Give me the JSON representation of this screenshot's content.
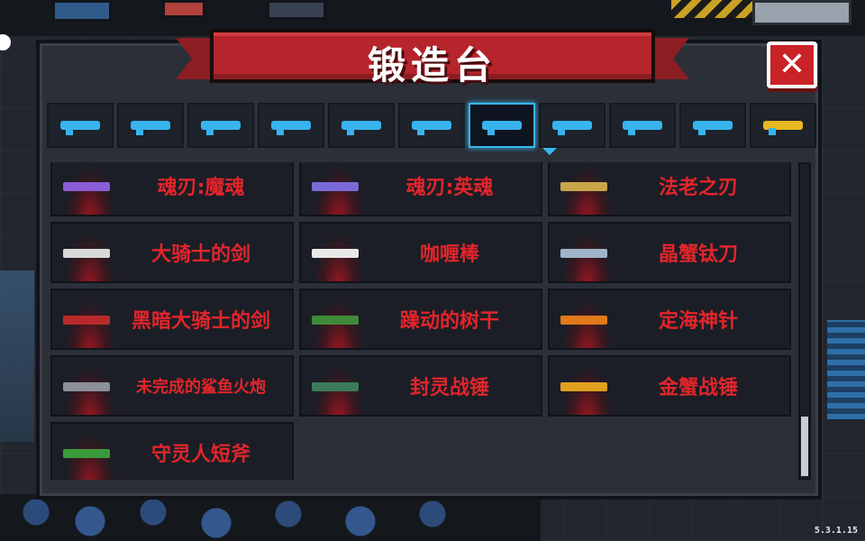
{
  "title": "锻造台",
  "close_icon": "close-x-icon",
  "colors": {
    "banner": "#b5252b",
    "close": "#c92227",
    "accent": "#37b4ee",
    "item_text": "#e2252b"
  },
  "tabs": [
    {
      "icon": "pistol-icon",
      "active": false
    },
    {
      "icon": "rifle-icon",
      "active": false
    },
    {
      "icon": "shotgun-icon",
      "active": false
    },
    {
      "icon": "launcher-icon",
      "active": false
    },
    {
      "icon": "laser-gun-icon",
      "active": false
    },
    {
      "icon": "bow-icon",
      "active": false
    },
    {
      "icon": "sword-icon",
      "active": true
    },
    {
      "icon": "spear-icon",
      "active": false
    },
    {
      "icon": "shuriken-icon",
      "active": false
    },
    {
      "icon": "fish-icon",
      "active": false
    },
    {
      "icon": "special-icon",
      "active": false
    }
  ],
  "items": [
    {
      "name": "魂刃:魔魂",
      "icon": "soul-blade-demon-icon",
      "icon_color": "#8a5cd6"
    },
    {
      "name": "魂刃:英魂",
      "icon": "soul-blade-hero-icon",
      "icon_color": "#7a6ad8"
    },
    {
      "name": "法老之刃",
      "icon": "pharaoh-blade-icon",
      "icon_color": "#c9a64a"
    },
    {
      "name": "大骑士的剑",
      "icon": "grand-knight-sword-icon",
      "icon_color": "#d9d9d9"
    },
    {
      "name": "咖喱棒",
      "icon": "curry-stick-icon",
      "icon_color": "#e8e8e8"
    },
    {
      "name": "晶蟹钛刀",
      "icon": "crystal-crab-blade-icon",
      "icon_color": "#9fb4c8"
    },
    {
      "name": "黑暗大骑士的剑",
      "icon": "dark-knight-sword-icon",
      "icon_color": "#b82a2a"
    },
    {
      "name": "躁动的树干",
      "icon": "restless-trunk-icon",
      "icon_color": "#3f8a3a"
    },
    {
      "name": "定海神针",
      "icon": "golden-staff-icon",
      "icon_color": "#e07a1a"
    },
    {
      "name": "未完成的鲨鱼火炮",
      "icon": "shark-cannon-icon",
      "icon_color": "#8a8f98"
    },
    {
      "name": "封灵战锤",
      "icon": "spirit-hammer-icon",
      "icon_color": "#3a7a5a"
    },
    {
      "name": "金蟹战锤",
      "icon": "golden-crab-hammer-icon",
      "icon_color": "#e0a020"
    },
    {
      "name": "守灵人短斧",
      "icon": "warden-axe-icon",
      "icon_color": "#3a9a3a"
    }
  ],
  "version": "5.3.1.15"
}
